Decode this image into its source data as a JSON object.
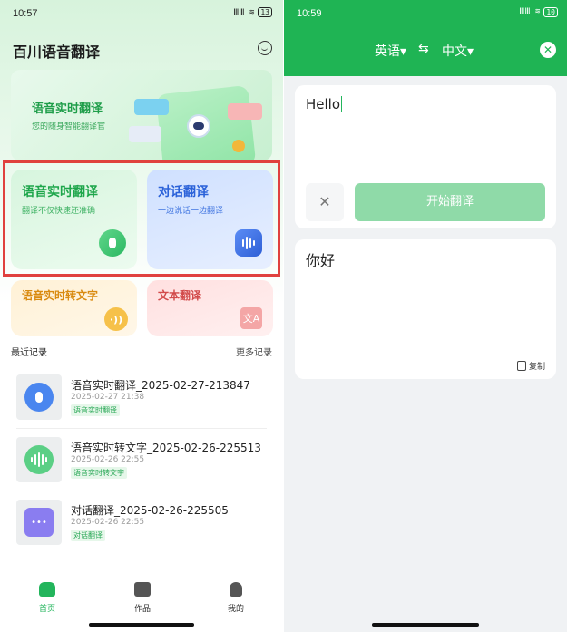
{
  "left": {
    "status_time": "10:57",
    "status_icons": "ⅢⅢ ≋",
    "battery": "13",
    "app_title": "百川语音翻译",
    "banner": {
      "title": "语音实时翻译",
      "subtitle": "您的随身智能翻译官"
    },
    "cards": {
      "realtime": {
        "title": "语音实时翻译",
        "subtitle": "翻译不仅快速还准确"
      },
      "dialogue": {
        "title": "对话翻译",
        "subtitle": "一边说话一边翻译"
      },
      "speech_to_text": {
        "title": "语音实时转文字"
      },
      "text_translate": {
        "title": "文本翻译",
        "icon_glyph": "文A"
      }
    },
    "recent_label": "最近记录",
    "more_label": "更多记录",
    "records": [
      {
        "name": "语音实时翻译_2025-02-27-213847",
        "date": "2025-02-27 21:38",
        "tag": "语音实时翻译",
        "icon": "microphone-icon",
        "color": "#4a86ef"
      },
      {
        "name": "语音实时转文字_2025-02-26-225513",
        "date": "2025-02-26 22:55",
        "tag": "语音实时转文字",
        "icon": "sound-wave-icon",
        "color": "#5bcf85"
      },
      {
        "name": "对话翻译_2025-02-26-225505",
        "date": "2025-02-26 22:55",
        "tag": "对话翻译",
        "icon": "chat-bubbles-icon",
        "color": "#8a7df0"
      }
    ],
    "tabs": [
      {
        "label": "首页",
        "icon": "home-icon"
      },
      {
        "label": "作品",
        "icon": "folder-icon"
      },
      {
        "label": "我的",
        "icon": "person-icon"
      }
    ]
  },
  "right": {
    "status_time": "10:59",
    "battery": "10",
    "source_lang": "英语▾",
    "swap_glyph": "⇆",
    "target_lang": "中文▾",
    "input_text": "Hello",
    "start_button": "开始翻译",
    "output_text": "你好",
    "copy_label": "复制"
  },
  "colors": {
    "brand_green": "#1fb454",
    "highlight_red": "#e0413e"
  }
}
